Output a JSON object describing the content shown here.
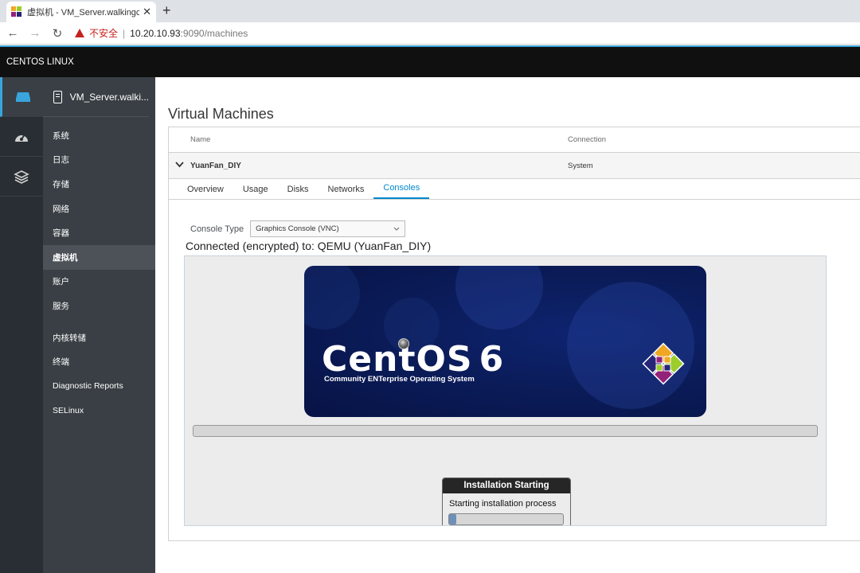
{
  "browser": {
    "tab_title": "虚拟机 - VM_Server.walkingclo",
    "close_glyph": "✕",
    "new_tab_glyph": "+",
    "security_label": "不安全",
    "separator": "|",
    "url_host": "10.20.10.93",
    "url_rest": ":9090/machines",
    "back_glyph": "←",
    "forward_glyph": "→",
    "reload_glyph": "↻"
  },
  "header": {
    "brand": "CENTOS LINUX"
  },
  "host": {
    "name": "VM_Server.walki..."
  },
  "sidebar": {
    "items": [
      {
        "label": "系统"
      },
      {
        "label": "日志"
      },
      {
        "label": "存储"
      },
      {
        "label": "网络"
      },
      {
        "label": "容器"
      },
      {
        "label": "虚拟机"
      },
      {
        "label": "账户"
      },
      {
        "label": "服务"
      }
    ],
    "tools": [
      {
        "label": "内核转储"
      },
      {
        "label": "终端"
      },
      {
        "label": "Diagnostic Reports"
      },
      {
        "label": "SELinux"
      }
    ]
  },
  "main": {
    "title": "Virtual Machines",
    "columns": {
      "name": "Name",
      "connection": "Connection"
    },
    "vm": {
      "name": "YuanFan_DIY",
      "connection": "System"
    },
    "tabs": [
      "Overview",
      "Usage",
      "Disks",
      "Networks",
      "Consoles"
    ],
    "console_type_label": "Console Type",
    "console_type_value": "Graphics Console (VNC)",
    "connected_text": "Connected (encrypted) to: QEMU (YuanFan_DIY)"
  },
  "vnc": {
    "logo_text": "CentOS",
    "logo_version": "6",
    "logo_subtitle": "Community ENTerprise Operating System",
    "dialog_title": "Installation Starting",
    "dialog_message": "Starting installation process",
    "dialog_progress": 0.06
  },
  "colors": {
    "accent": "#0088ce",
    "header_bg": "#101010",
    "sidebar_bg": "#393f44",
    "rail_bg": "#292e34",
    "warning": "#c5221f"
  }
}
